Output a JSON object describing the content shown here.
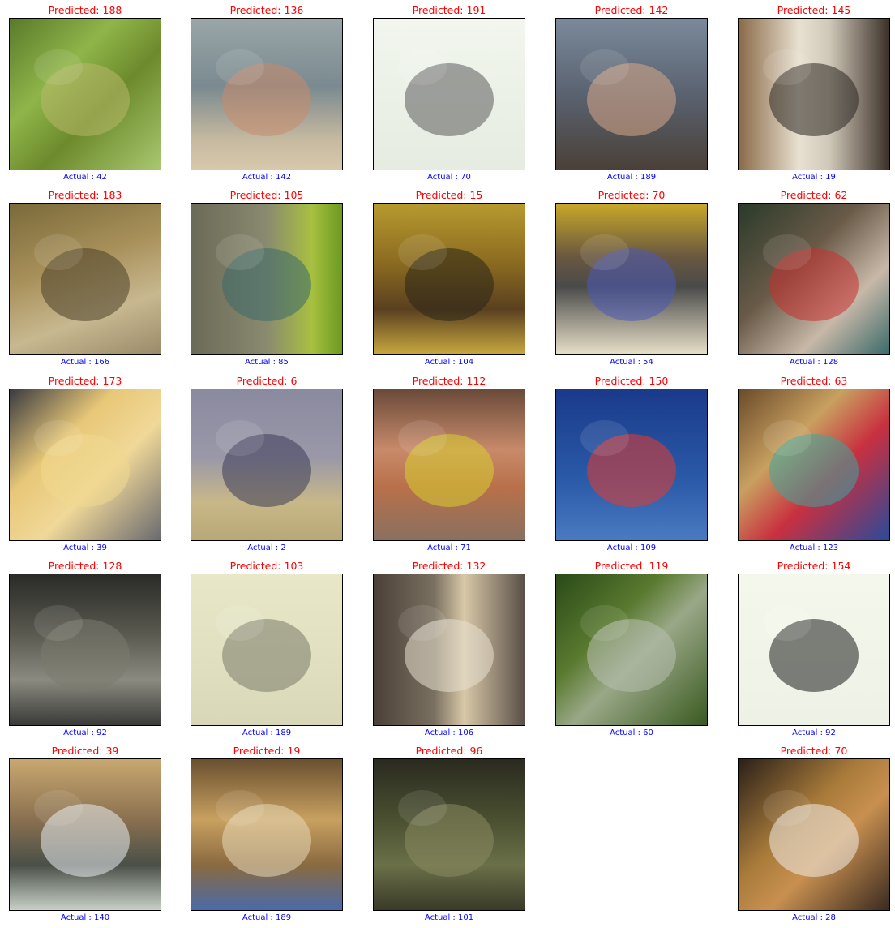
{
  "panels": [
    {
      "predicted": "Predicted: 188",
      "actual": "Actual : 42",
      "bg": "linear-gradient(135deg,#5a7a2a 0%,#8fb54a 35%,#6d8a2c 60%,#a8c870 100%)",
      "spot": "#b8b86a"
    },
    {
      "predicted": "Predicted: 136",
      "actual": "Actual : 142",
      "bg": "linear-gradient(180deg,#9aa6a8 0%,#7a8a90 45%,#c6b9a0 80%,#d8c8ac 100%)",
      "spot": "#c88a6a"
    },
    {
      "predicted": "Predicted: 191",
      "actual": "Actual : 70",
      "bg": "linear-gradient(180deg,#f2f6ee 0%,#e6ece2 100%)",
      "spot": "#5a5a5a"
    },
    {
      "predicted": "Predicted: 142",
      "actual": "Actual : 189",
      "bg": "linear-gradient(180deg,#7a8a9a 0%,#5a6270 50%,#4a4038 100%)",
      "spot": "#d8a888"
    },
    {
      "predicted": "Predicted: 145",
      "actual": "Actual : 19",
      "bg": "linear-gradient(90deg,#8a6a48 0%,#e8e0d0 40%,#d0c8b8 60%,#3a3028 100%)",
      "spot": "#2a2420"
    },
    {
      "predicted": "Predicted: 183",
      "actual": "Actual : 166",
      "bg": "linear-gradient(160deg,#7a6a3a 0%,#a8905a 40%,#c8b890 70%,#9a8a6a 100%)",
      "spot": "#4a4028"
    },
    {
      "predicted": "Predicted: 105",
      "actual": "Actual : 85",
      "bg": "linear-gradient(90deg,#6a6a58 0%,#8a8a70 50%,#a8c040 80%,#6a9a20 100%)",
      "spot": "#3a6a6a"
    },
    {
      "predicted": "Predicted: 15",
      "actual": "Actual : 104",
      "bg": "linear-gradient(180deg,#b89a30 0%,#8a6a20 40%,#5a4020 70%,#c8a840 100%)",
      "spot": "#2a2418"
    },
    {
      "predicted": "Predicted: 70",
      "actual": "Actual : 54",
      "bg": "linear-gradient(180deg,#c8a828 0%,#6a5840 35%,#4a4a4a 55%,#e8e0c8 100%)",
      "spot": "#4a5ab8"
    },
    {
      "predicted": "Predicted: 62",
      "actual": "Actual : 128",
      "bg": "linear-gradient(135deg,#2a3a2a 0%,#6a5a48 40%,#c8b8a8 70%,#3a6a6a 100%)",
      "spot": "#c83030"
    },
    {
      "predicted": "Predicted: 173",
      "actual": "Actual : 39",
      "bg": "linear-gradient(135deg,#3a3a40 0%,#e8c878 35%,#f0d898 60%,#6a6a70 100%)",
      "spot": "#f0d890"
    },
    {
      "predicted": "Predicted: 6",
      "actual": "Actual : 2",
      "bg": "linear-gradient(180deg,#8a8aa0 0%,#9a98a8 45%,#c8b888 75%,#b8a878 100%)",
      "spot": "#3a3a58"
    },
    {
      "predicted": "Predicted: 112",
      "actual": "Actual : 71",
      "bg": "linear-gradient(180deg,#6a4a3a 0%,#c88a6a 40%,#b8704a 65%,#8a7060 100%)",
      "spot": "#d8d030"
    },
    {
      "predicted": "Predicted: 150",
      "actual": "Actual : 109",
      "bg": "linear-gradient(180deg,#1a3a8a 0%,#2a5aa8 60%,#4a7ac0 100%)",
      "spot": "#e83a2a"
    },
    {
      "predicted": "Predicted: 63",
      "actual": "Actual : 123",
      "bg": "linear-gradient(135deg,#6a4a2a 0%,#c8a060 35%,#c83040 60%,#2a4a9a 100%)",
      "spot": "#3aa8a0"
    },
    {
      "predicted": "Predicted: 128",
      "actual": "Actual : 92",
      "bg": "linear-gradient(180deg,#2a2a28 0%,#5a5a50 40%,#8a8a80 70%,#3a3a38 100%)",
      "spot": "#7a7a70"
    },
    {
      "predicted": "Predicted: 103",
      "actual": "Actual : 189",
      "bg": "linear-gradient(180deg,#e8e8c8 0%,#e0e0c0 60%,#d8d8b8 100%)",
      "spot": "#7a7a6a"
    },
    {
      "predicted": "Predicted: 132",
      "actual": "Actual : 106",
      "bg": "linear-gradient(90deg,#4a4038 0%,#7a7060 40%,#d8c8a8 60%,#5a5048 100%)",
      "spot": "#e8e0d0"
    },
    {
      "predicted": "Predicted: 119",
      "actual": "Actual : 60",
      "bg": "linear-gradient(135deg,#2a4a18 0%,#5a7a30 35%,#9aa888 55%,#3a5a20 100%)",
      "spot": "#b8c0b0"
    },
    {
      "predicted": "Predicted: 154",
      "actual": "Actual : 92",
      "bg": "linear-gradient(180deg,#f4f8ec 0%,#eef2e6 100%)",
      "spot": "#1a1a1a"
    },
    {
      "predicted": "Predicted: 39",
      "actual": "Actual : 140",
      "bg": "linear-gradient(180deg,#c8a870 0%,#8a7050 40%,#4a5048 70%,#c8d0c8 100%)",
      "spot": "#e8ecf0"
    },
    {
      "predicted": "Predicted: 19",
      "actual": "Actual : 189",
      "bg": "linear-gradient(180deg,#6a5030 0%,#c8a060 40%,#8a6a40 70%,#4a6aa8 100%)",
      "spot": "#e8d8b8"
    },
    {
      "predicted": "Predicted: 96",
      "actual": "Actual : 101",
      "bg": "linear-gradient(180deg,#2a2a20 0%,#4a5030 40%,#6a7048 70%,#3a3a28 100%)",
      "spot": "#8a8a60"
    },
    null,
    {
      "predicted": "Predicted: 70",
      "actual": "Actual : 28",
      "bg": "linear-gradient(135deg,#2a2018 0%,#a87a3a 40%,#c89050 60%,#3a2a20 100%)",
      "spot": "#f0ece8"
    }
  ]
}
